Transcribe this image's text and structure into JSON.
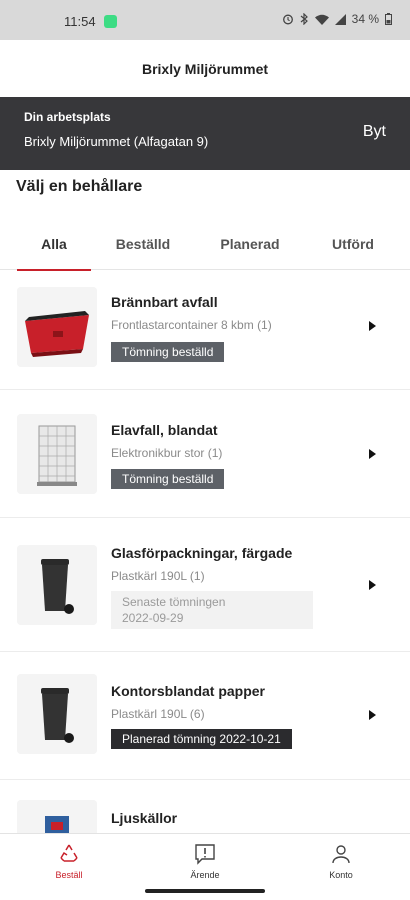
{
  "status_bar": {
    "time": "11:54",
    "battery": "34 %"
  },
  "app_bar": {
    "title": "Brixly Miljörummet"
  },
  "workplace": {
    "label": "Din arbetsplats",
    "value": "Brixly Miljörummet (Alfagatan 9)",
    "change_label": "Byt"
  },
  "section_title": "Välj en behållare",
  "tabs": [
    {
      "label": "Alla",
      "active": true
    },
    {
      "label": "Beställd",
      "active": false
    },
    {
      "label": "Planerad",
      "active": false
    },
    {
      "label": "Utförd",
      "active": false
    }
  ],
  "items": [
    {
      "title": "Brännbart avfall",
      "subtitle": "Frontlastarcontainer 8 kbm (1)",
      "status": "Tömning beställd",
      "status_style": "ordered",
      "image": "red-container"
    },
    {
      "title": "Elavfall, blandat",
      "subtitle": "Elektronikbur stor (1)",
      "status": "Tömning beställd",
      "status_style": "ordered",
      "image": "wire-cage"
    },
    {
      "title": "Glasförpackningar, färgade",
      "subtitle": "Plastkärl 190L (1)",
      "status_line1": "Senaste tömningen",
      "status_line2": "2022-09-29",
      "status_style": "last-emptied",
      "image": "wheelie-bin"
    },
    {
      "title": "Kontorsblandat papper",
      "subtitle": "Plastkärl 190L (6)",
      "status": "Planerad tömning 2022-10-21",
      "status_style": "planned",
      "image": "wheelie-bin"
    },
    {
      "title": "Ljuskällor",
      "image": "blue-box"
    }
  ],
  "bottom_nav": [
    {
      "label": "Beställ",
      "icon": "recycle-icon",
      "active": true
    },
    {
      "label": "Ärende",
      "icon": "message-alert-icon",
      "active": false
    },
    {
      "label": "Konto",
      "icon": "user-icon",
      "active": false
    }
  ],
  "colors": {
    "accent": "#c8202a",
    "header_band": "#37373a",
    "badge_ordered": "#5d6167",
    "badge_planned": "#2b2b2e"
  }
}
